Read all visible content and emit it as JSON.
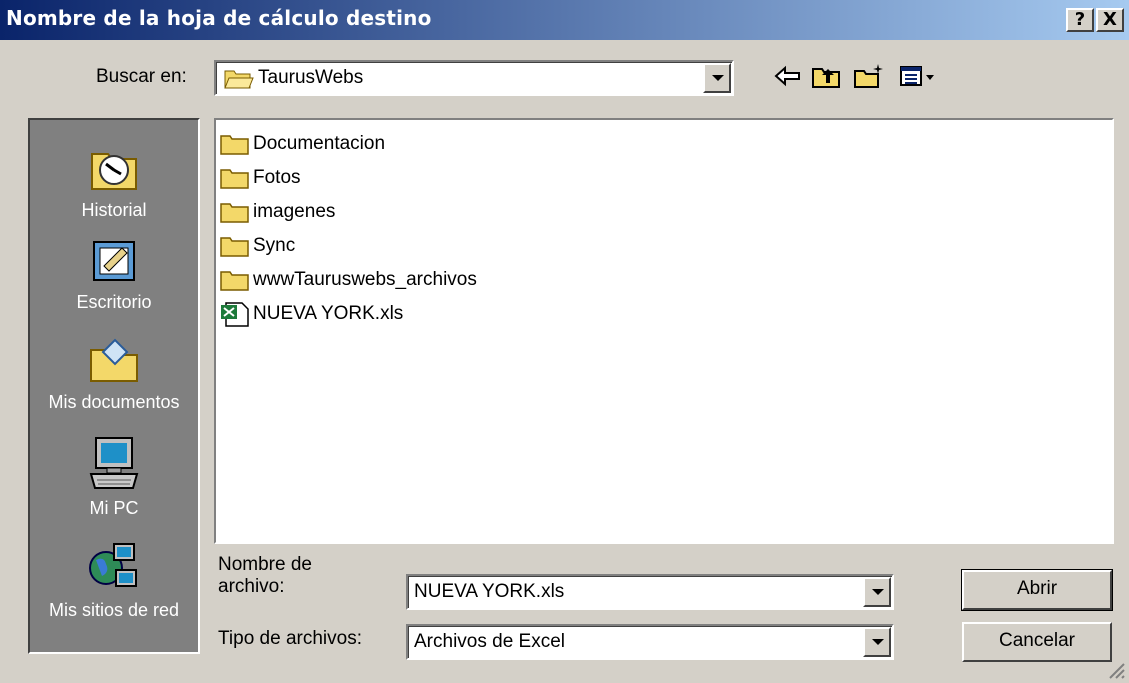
{
  "window": {
    "title": "Nombre de la hoja de cálculo destino",
    "help_label": "?",
    "close_label": "X"
  },
  "lookin": {
    "label": "Buscar en:",
    "value": "TaurusWebs"
  },
  "toolbar": {
    "icons": [
      "back-arrow-icon",
      "up-folder-icon",
      "new-folder-icon",
      "view-menu-icon"
    ]
  },
  "places": [
    {
      "label": "Historial",
      "icon": "history-icon"
    },
    {
      "label": "Escritorio",
      "icon": "desktop-icon"
    },
    {
      "label": "Mis documentos",
      "icon": "my-documents-icon"
    },
    {
      "label": "Mi PC",
      "icon": "my-computer-icon"
    },
    {
      "label": "Mis sitios de red",
      "icon": "network-places-icon"
    }
  ],
  "files": [
    {
      "name": "Documentacion",
      "type": "folder"
    },
    {
      "name": "Fotos",
      "type": "folder"
    },
    {
      "name": "imagenes",
      "type": "folder"
    },
    {
      "name": "Sync",
      "type": "folder"
    },
    {
      "name": "wwwTauruswebs_archivos",
      "type": "folder"
    },
    {
      "name": "NUEVA YORK.xls",
      "type": "excel"
    }
  ],
  "filename": {
    "label_line1": "Nombre de",
    "label_line2": "archivo:",
    "value": "NUEVA YORK.xls"
  },
  "filetype": {
    "label": "Tipo de archivos:",
    "value": "Archivos de Excel"
  },
  "buttons": {
    "open": "Abrir",
    "cancel": "Cancelar"
  }
}
